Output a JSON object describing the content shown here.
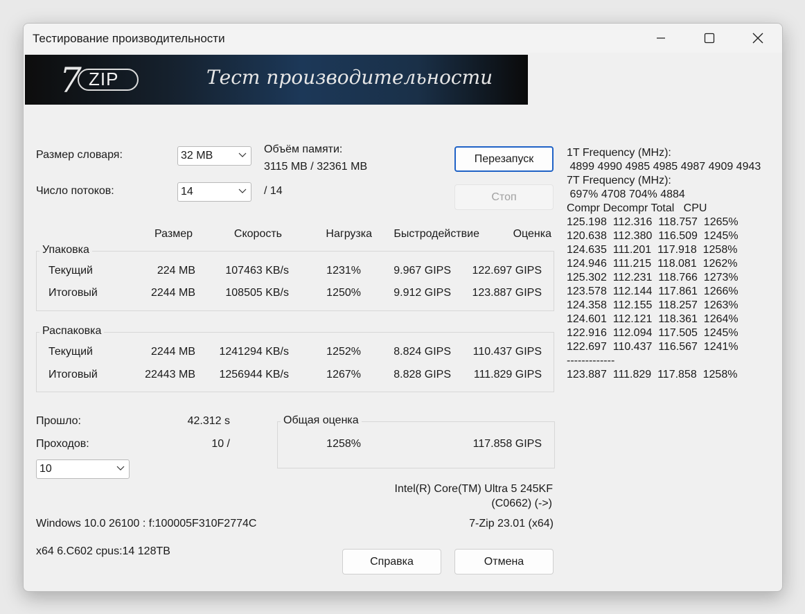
{
  "window": {
    "title": "Тестирование производительности",
    "controls": [
      "minimize-icon",
      "maximize-icon",
      "close-icon"
    ]
  },
  "banner": {
    "logo_text": "ZIP",
    "logo_digit": "7",
    "caption": "Тест производительности"
  },
  "settings": {
    "dict_label": "Размер словаря:",
    "dict_value": "32 MB",
    "threads_label": "Число потоков:",
    "threads_value": "14",
    "threads_max": "/ 14",
    "memory_label": "Объём памяти:",
    "memory_value": "3115 MB / 32361 MB"
  },
  "buttons": {
    "restart": "Перезапуск",
    "stop": "Стоп",
    "help": "Справка",
    "cancel": "Отмена"
  },
  "columns": [
    "Размер",
    "Скорость",
    "Нагрузка",
    "Быстродействие",
    "Оценка"
  ],
  "compress": {
    "title": "Упаковка",
    "rows": [
      {
        "label": "Текущий",
        "size": "224 MB",
        "speed": "107463 KB/s",
        "load": "1231%",
        "perf": "9.967 GIPS",
        "rating": "122.697 GIPS"
      },
      {
        "label": "Итоговый",
        "size": "2244 MB",
        "speed": "108505 KB/s",
        "load": "1250%",
        "perf": "9.912 GIPS",
        "rating": "123.887 GIPS"
      }
    ]
  },
  "decompress": {
    "title": "Распаковка",
    "rows": [
      {
        "label": "Текущий",
        "size": "2244 MB",
        "speed": "1241294 KB/s",
        "load": "1252%",
        "perf": "8.824 GIPS",
        "rating": "110.437 GIPS"
      },
      {
        "label": "Итоговый",
        "size": "22443 MB",
        "speed": "1256944 KB/s",
        "load": "1267%",
        "perf": "8.828 GIPS",
        "rating": "111.829 GIPS"
      }
    ]
  },
  "elapsed": {
    "label": "Прошло:",
    "value": "42.312 s"
  },
  "passes": {
    "label": "Проходов:",
    "value": "10 /",
    "select_value": "10"
  },
  "total": {
    "title": "Общая оценка",
    "load": "1258%",
    "rating": "117.858 GIPS"
  },
  "cpu": {
    "line1": "Intel(R) Core(TM) Ultra 5 245KF",
    "line2": "(C0662) (->)"
  },
  "os": {
    "line1": "Windows 10.0 26100 :  f:100005F310F2774C",
    "line2": "x64 6.C602 cpus:14 128TB"
  },
  "version": "7-Zip 23.01 (x64)",
  "log": {
    "lines": [
      "1T Frequency (MHz):",
      " 4899 4990 4985 4985 4987 4909 4943",
      "7T Frequency (MHz):",
      " 697% 4708 704% 4884",
      "Compr Decompr Total   CPU",
      "125.198  112.316  118.757  1265%",
      "120.638  112.380  116.509  1245%",
      "124.635  111.201  117.918  1258%",
      "124.946  111.215  118.081  1262%",
      "125.302  112.231  118.766  1273%",
      "123.578  112.144  117.861  1266%",
      "124.358  112.155  118.257  1263%",
      "124.601  112.121  118.361  1264%",
      "122.916  112.094  117.505  1245%",
      "122.697  110.437  116.567  1241%",
      "-------------",
      "",
      "123.887  111.829  117.858  1258%"
    ]
  }
}
